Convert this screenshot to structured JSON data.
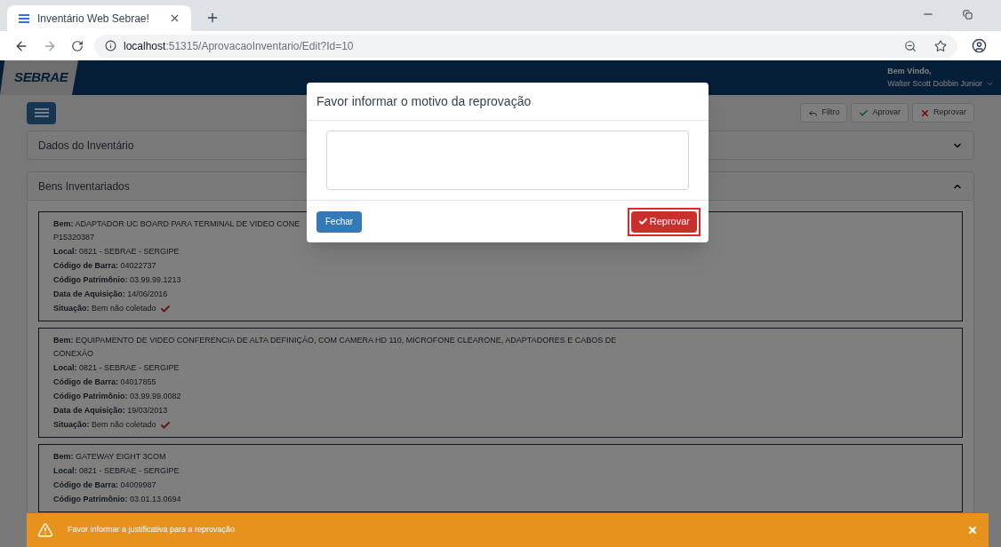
{
  "browser": {
    "tab_title": "Inventário Web Sebrae!",
    "url_host": "localhost",
    "url_path": ":51315/AprovacaoInventario/Edit?Id=10"
  },
  "header": {
    "logo": "SEBRAE",
    "welcome": "Bem Vindo,",
    "user": "Walter Scott Dobbin Junior"
  },
  "toolbar": {
    "buttons": [
      {
        "label": "Filtro",
        "kind": "back"
      },
      {
        "label": "Aprovar",
        "kind": "approve"
      },
      {
        "label": "Reprovar",
        "kind": "reject"
      }
    ]
  },
  "panels": [
    {
      "title": "Dados do Inventário",
      "expanded": false
    },
    {
      "title": "Bens Inventariados",
      "expanded": true
    }
  ],
  "items": [
    {
      "fields": [
        {
          "label": "Bem:",
          "value": [
            "ADAPTADOR UC BOARD PARA TERMINAL DE VIDEO CONE",
            "P15320387"
          ]
        },
        {
          "label": "Local:",
          "value": [
            "0821 - SEBRAE - SERGIPE"
          ]
        },
        {
          "label": "Código de Barra:",
          "value": [
            "04022737"
          ]
        },
        {
          "label": "Código Patrimônio:",
          "value": [
            "03.99.99.1213"
          ]
        },
        {
          "label": "Data de Aquisição:",
          "value": [
            "14/06/2016"
          ]
        },
        {
          "label": "Situação:",
          "value": [
            "Bem não coletado"
          ],
          "checked": true
        }
      ]
    },
    {
      "fields": [
        {
          "label": "Bem:",
          "value": [
            "EQUIPAMENTO DE VIDEO CONFERENCIA DE ALTA DEFINIÇÃO, COM CAMERA HD 110, MICROFONE CLEARONE, ADAPTADORES E CABOS DE",
            "CONEXÃO"
          ]
        },
        {
          "label": "Local:",
          "value": [
            "0821 - SEBRAE - SERGIPE"
          ]
        },
        {
          "label": "Código de Barra:",
          "value": [
            "04017855"
          ]
        },
        {
          "label": "Código Patrimônio:",
          "value": [
            "03.99.99.0082"
          ]
        },
        {
          "label": "Data de Aquisição:",
          "value": [
            "19/03/2013"
          ]
        },
        {
          "label": "Situação:",
          "value": [
            "Bem não coletado"
          ],
          "checked": true
        }
      ]
    },
    {
      "fields": [
        {
          "label": "Bem:",
          "value": [
            "GATEWAY EIGHT 3COM"
          ]
        },
        {
          "label": "Local:",
          "value": [
            "0821 - SEBRAE - SERGIPE"
          ]
        },
        {
          "label": "Código de Barra:",
          "value": [
            "04009987"
          ]
        },
        {
          "label": "Código Patrimônio:",
          "value": [
            "03.01.13.0694"
          ]
        }
      ]
    }
  ],
  "modal": {
    "title": "Favor informar o motivo da reprovação",
    "close_button": "Fechar",
    "reject_button": "Reprovar"
  },
  "toast": {
    "message": "Favor informar a justificativa para a reprovação"
  }
}
